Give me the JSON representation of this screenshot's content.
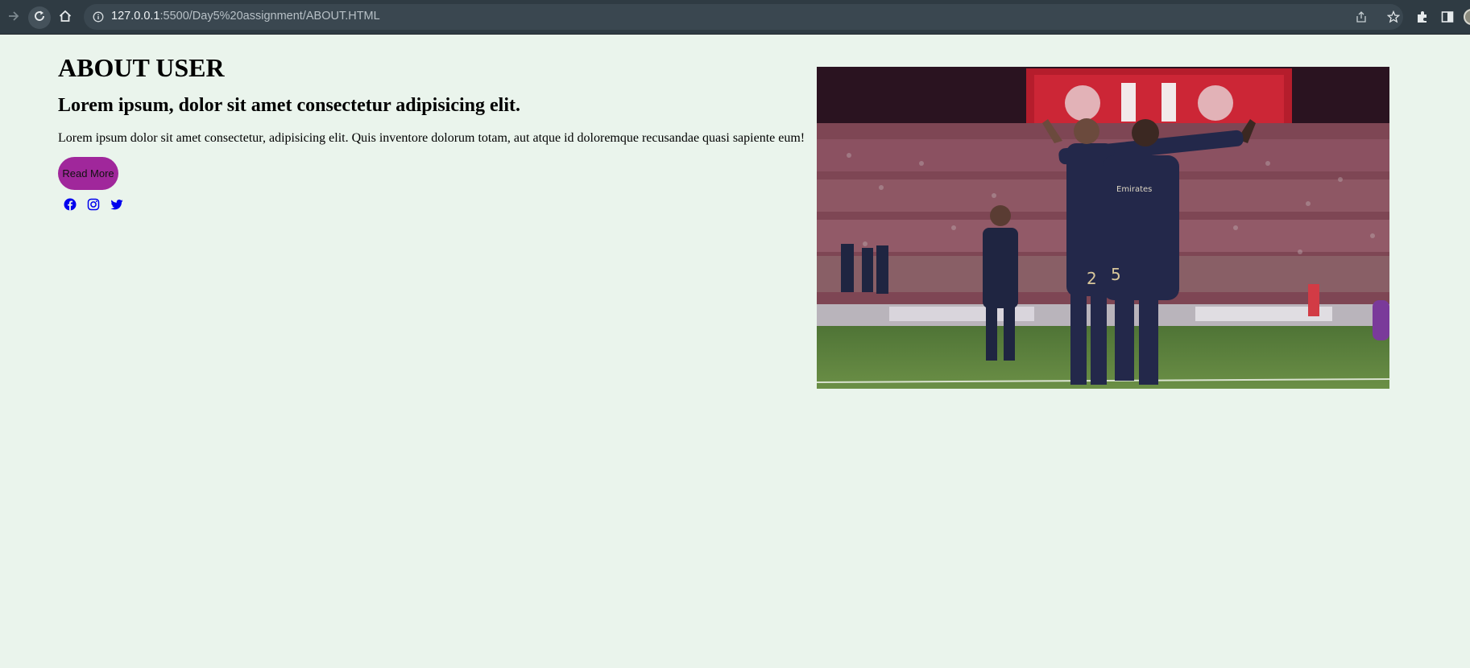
{
  "browser": {
    "url_host": "127.0.0.1",
    "url_path": ":5500/Day5%20assignment/ABOUT.HTML",
    "icons": [
      "forward-icon",
      "reload-icon",
      "home-icon",
      "site-info-icon",
      "share-icon",
      "bookmark-star-icon",
      "extensions-icon",
      "side-panel-icon",
      "profile-avatar"
    ]
  },
  "page": {
    "heading": "ABOUT USER",
    "subheading": "Lorem ipsum, dolor sit amet consectetur adipisicing elit.",
    "paragraph": "Lorem ipsum dolor sit amet consectetur, adipisicing elit. Quis inventore dolorum totam, aut atque id doloremque recusandae quasi sapiente eum!",
    "button_label": "Read More",
    "social_icons": [
      "facebook-icon",
      "instagram-icon",
      "twitter-icon"
    ],
    "image": "football-celebration-photo",
    "colors": {
      "background": "#eaf4ec",
      "button": "#a0279b",
      "social": "#0000ee",
      "browser_bar": "#2f3b43"
    }
  }
}
